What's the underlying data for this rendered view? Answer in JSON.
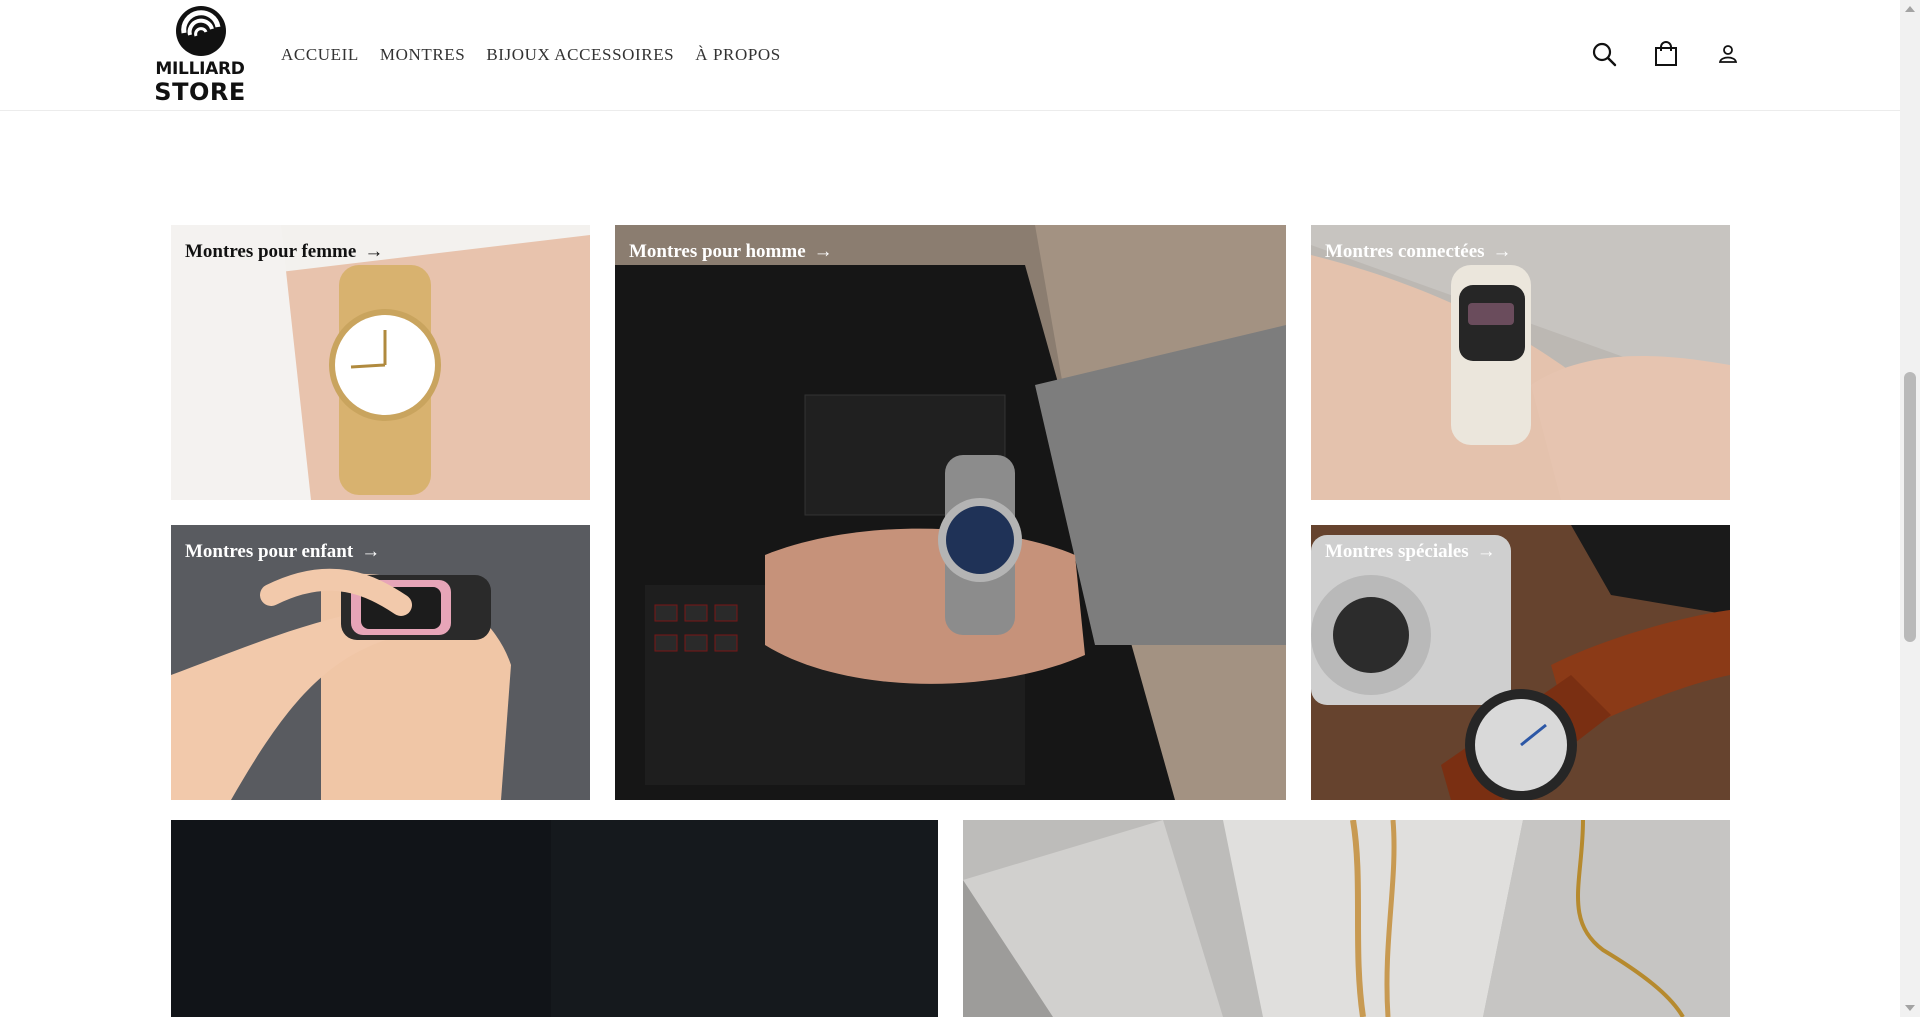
{
  "header": {
    "logo": {
      "line1": "MILLIARD",
      "line2": "STORE"
    },
    "nav": [
      {
        "label": "ACCUEIL"
      },
      {
        "label": "MONTRES"
      },
      {
        "label": "BIJOUX ACCESSOIRES"
      },
      {
        "label": "À PROPOS"
      }
    ],
    "icons": [
      "search-icon",
      "bag-icon",
      "account-icon"
    ]
  },
  "collections": [
    {
      "label": "Montres pour femme",
      "arrow": "→",
      "label_color": "#111111"
    },
    {
      "label": "Montres pour homme",
      "arrow": "→",
      "label_color": "#ffffff"
    },
    {
      "label": "Montres connectées",
      "arrow": "→",
      "label_color": "#ffffff"
    },
    {
      "label": "Montres pour enfant",
      "arrow": "→",
      "label_color": "#ffffff"
    },
    {
      "label": "Montres spéciales",
      "arrow": "→",
      "label_color": "#ffffff"
    }
  ]
}
